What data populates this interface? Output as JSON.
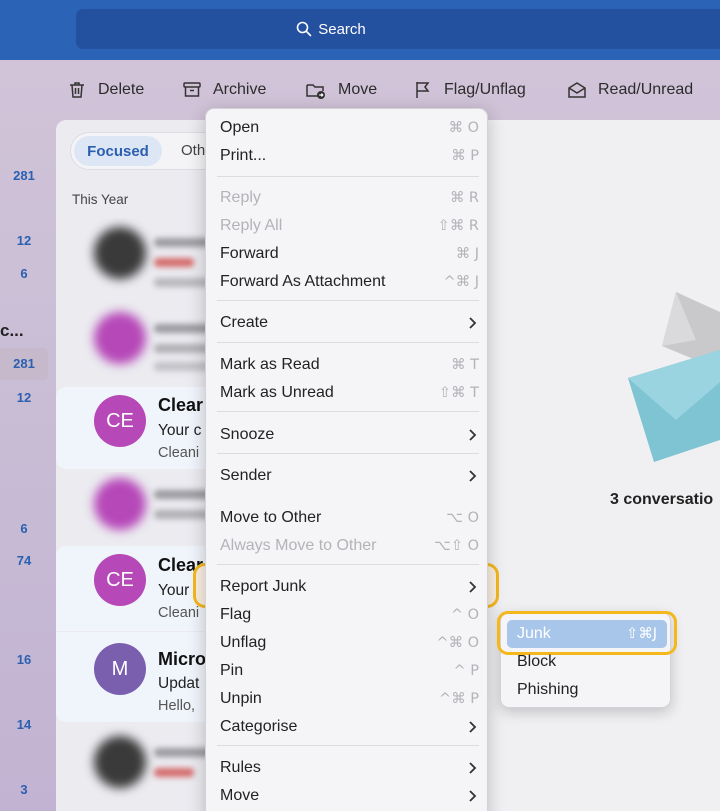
{
  "search": {
    "label": "Search"
  },
  "toolbar": {
    "delete": "Delete",
    "archive": "Archive",
    "move": "Move",
    "flag": "Flag/Unflag",
    "read": "Read/Unread"
  },
  "folder_counts": [
    "281",
    "12",
    "6",
    "281",
    "12",
    "6",
    "74",
    "16",
    "14",
    "3"
  ],
  "folder_truncated": "c...",
  "mail_list": {
    "tab_focused": "Focused",
    "tab_other": "Oth",
    "section": "This Year",
    "rows": [
      {
        "initials": "CE",
        "sender": "Clear",
        "subject": "Your c",
        "preview": "Cleani",
        "avatar_color": "#b648b8"
      },
      {
        "initials": "CE",
        "sender": "Clear",
        "subject": "Your c",
        "preview": "Cleani",
        "avatar_color": "#b648b8"
      },
      {
        "initials": "M",
        "sender": "Micro",
        "subject": "Updat",
        "preview": "Hello,",
        "avatar_color": "#7a5fae"
      }
    ]
  },
  "reading_pane": {
    "status": "3 conversatio"
  },
  "context_menu": {
    "items": [
      {
        "label": "Open",
        "shortcut": "⌘ O",
        "disabled": false
      },
      {
        "label": "Print...",
        "shortcut": "⌘ P",
        "disabled": false
      },
      {
        "label": "Reply",
        "shortcut": "⌘ R",
        "disabled": true
      },
      {
        "label": "Reply All",
        "shortcut": "⇧⌘ R",
        "disabled": true
      },
      {
        "label": "Forward",
        "shortcut": "⌘ J",
        "disabled": false
      },
      {
        "label": "Forward As Attachment",
        "shortcut": "^⌘ J",
        "disabled": false
      },
      {
        "label": "Create",
        "shortcut": "",
        "disabled": false
      },
      {
        "label": "Mark as Read",
        "shortcut": "⌘ T",
        "disabled": false
      },
      {
        "label": "Mark as Unread",
        "shortcut": "⇧⌘ T",
        "disabled": false
      },
      {
        "label": "Snooze",
        "shortcut": "",
        "disabled": false
      },
      {
        "label": "Sender",
        "shortcut": "",
        "disabled": false
      },
      {
        "label": "Move to Other",
        "shortcut": "⌥ O",
        "disabled": false
      },
      {
        "label": "Always Move to Other",
        "shortcut": "⌥⇧ O",
        "disabled": true
      },
      {
        "label": "Report Junk",
        "shortcut": "",
        "disabled": false
      },
      {
        "label": "Flag",
        "shortcut": "^ O",
        "disabled": false
      },
      {
        "label": "Unflag",
        "shortcut": "^⌘ O",
        "disabled": false
      },
      {
        "label": "Pin",
        "shortcut": "^ P",
        "disabled": false
      },
      {
        "label": "Unpin",
        "shortcut": "^⌘ P",
        "disabled": false
      },
      {
        "label": "Categorise",
        "shortcut": "",
        "disabled": false
      },
      {
        "label": "Rules",
        "shortcut": "",
        "disabled": false
      },
      {
        "label": "Move",
        "shortcut": "",
        "disabled": false
      }
    ]
  },
  "junk_submenu": {
    "junk": "Junk",
    "junk_shortcut": "⇧⌘J",
    "block": "Block",
    "phishing": "Phishing"
  },
  "colors": {
    "accent": "#2b63b6",
    "highlight_ring": "#f4b81d",
    "selected_item": "#a8c5ea"
  }
}
